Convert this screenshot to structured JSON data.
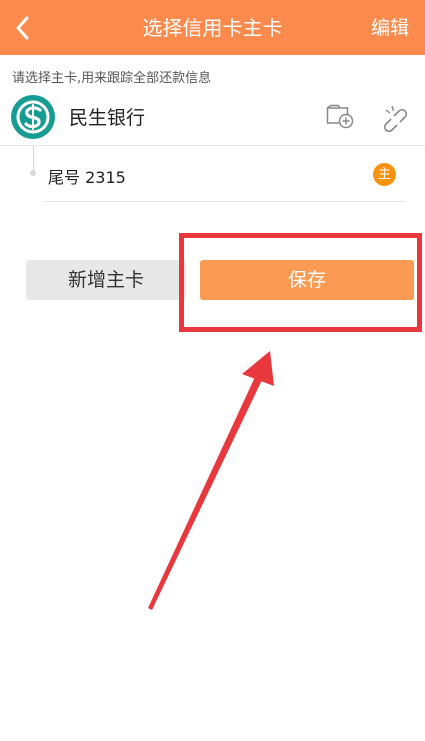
{
  "header": {
    "title": "选择信用卡主卡",
    "edit_label": "编辑",
    "icons": {
      "back": "back-chevron-icon"
    }
  },
  "hint": "请选择主卡,用来跟踪全部还款信息",
  "bank": {
    "name": "民生银行",
    "icons": {
      "logo": "minsheng-bank-logo-icon",
      "add_card": "add-card-icon",
      "unlink": "unlink-icon"
    }
  },
  "card": {
    "label": "尾号 2315",
    "badge": "主"
  },
  "buttons": {
    "add_main": "新增主卡",
    "save": "保存"
  },
  "colors": {
    "header": "#fb8a4c",
    "save_button": "#fb9a52",
    "badge": "#f7920f",
    "bank_logo": "#179c94",
    "annotation": "#e8383d"
  }
}
